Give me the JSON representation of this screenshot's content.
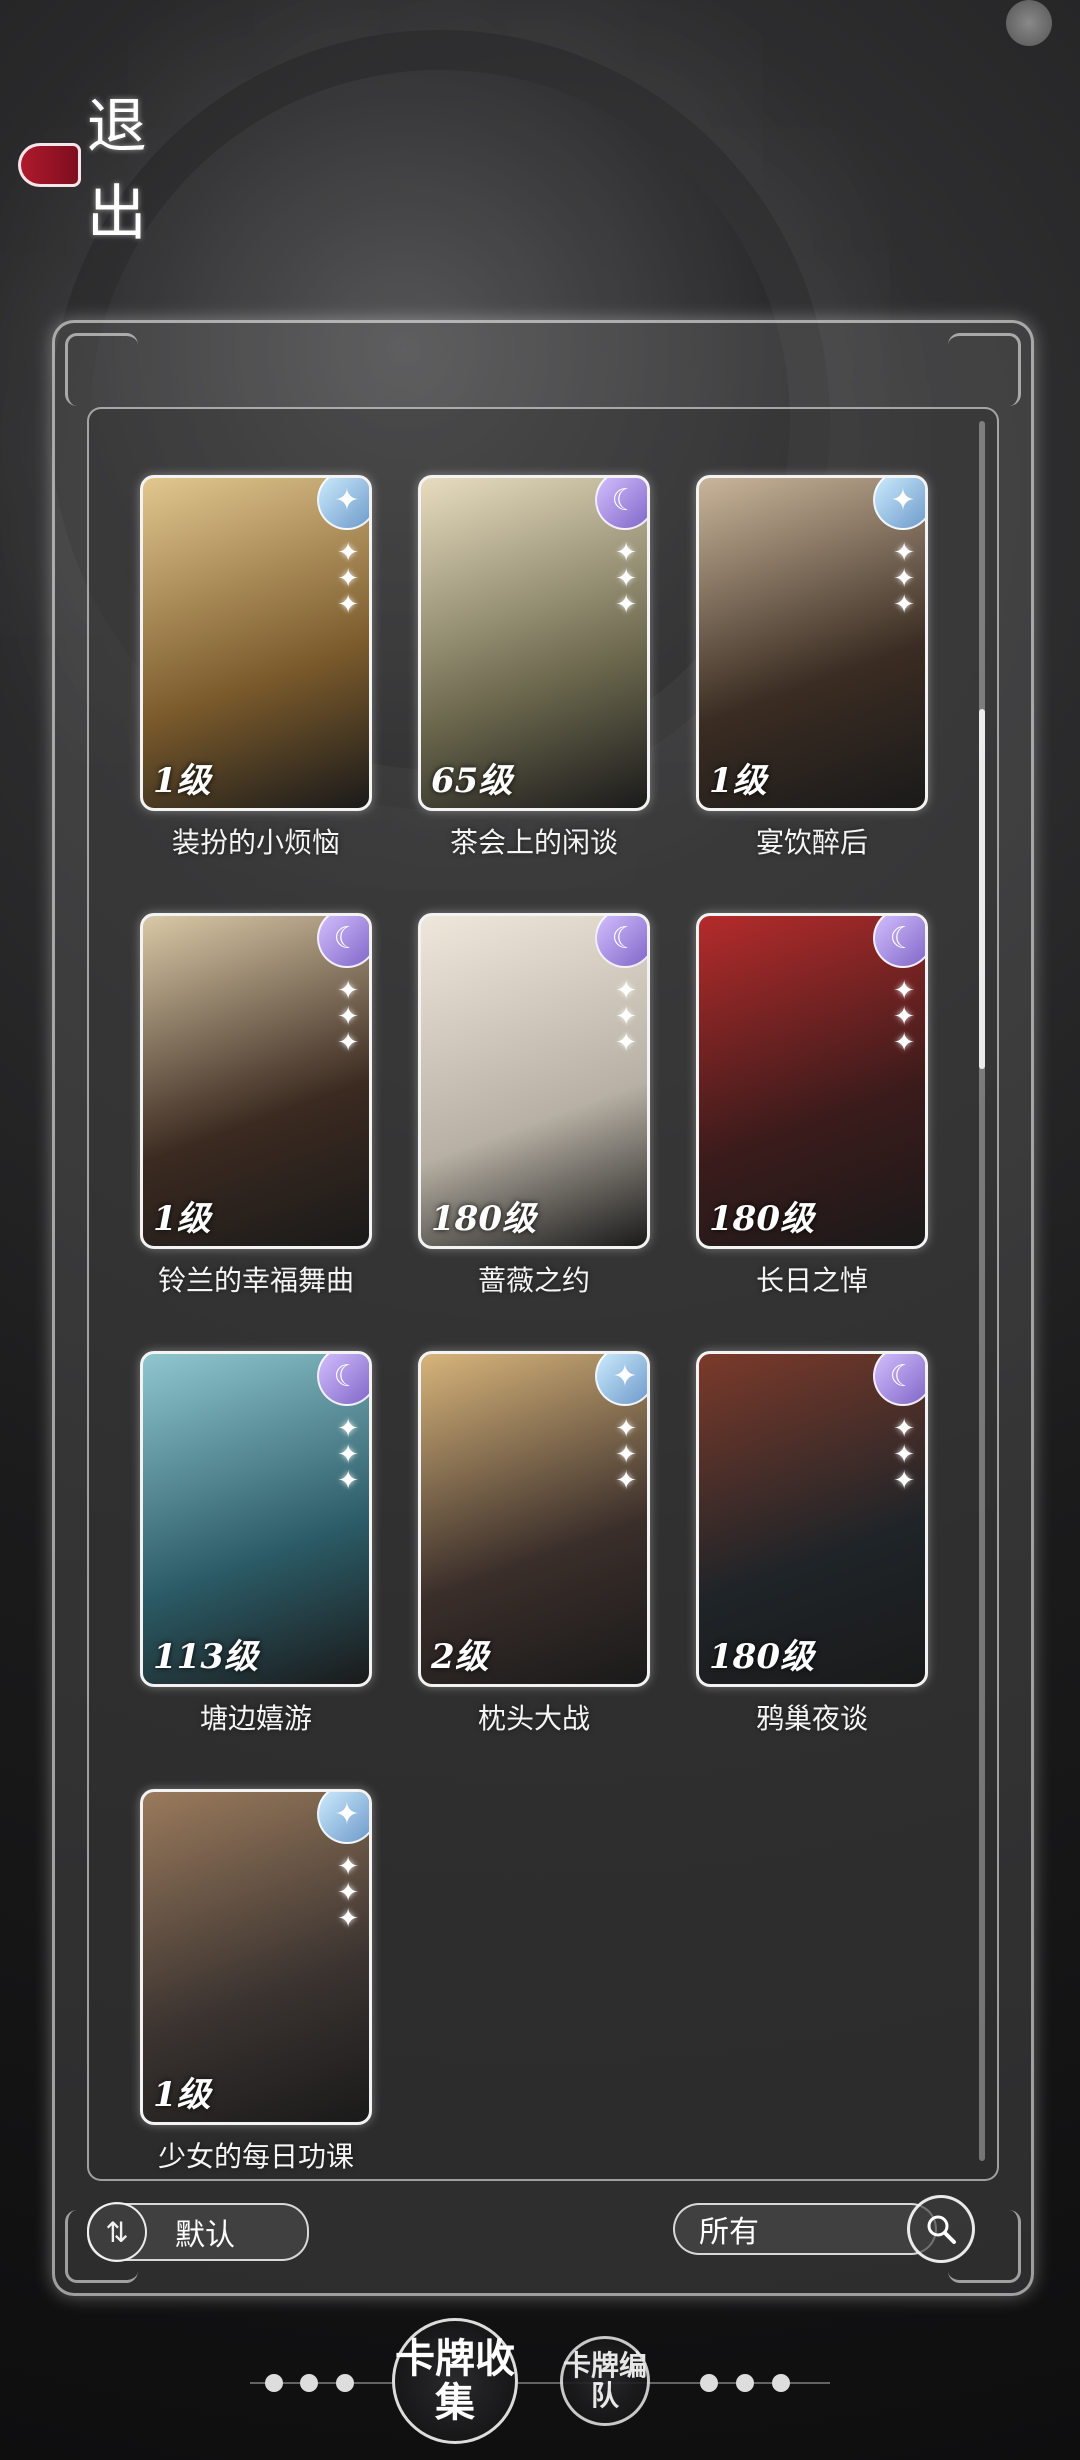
{
  "back_button": {
    "label": "退出"
  },
  "collection": {
    "partial_titles_above": [
      "",
      "",
      ""
    ],
    "cards": [
      {
        "title": "装扮的小烦恼",
        "level": "1级",
        "badge": "star-badge-icon",
        "art_colors": [
          "#7a5a2b",
          "#e2c78f"
        ]
      },
      {
        "title": "茶会上的闲谈",
        "level": "65级",
        "badge": "moon-badge-icon",
        "art_colors": [
          "#6e6a4f",
          "#e7dcc0"
        ]
      },
      {
        "title": "宴饮醉后",
        "level": "1级",
        "badge": "star-badge-icon",
        "art_colors": [
          "#3a2c22",
          "#c9b59a"
        ]
      },
      {
        "title": "铃兰的幸福舞曲",
        "level": "1级",
        "badge": "moon-badge-icon",
        "art_colors": [
          "#3b2a20",
          "#d9c9a7"
        ]
      },
      {
        "title": "蔷薇之约",
        "level": "180级",
        "badge": "moon-badge-icon",
        "art_colors": [
          "#b7b0a4",
          "#efe7da"
        ]
      },
      {
        "title": "长日之悼",
        "level": "180级",
        "badge": "moon-badge-icon",
        "art_colors": [
          "#3b1b1b",
          "#b52b2b"
        ]
      },
      {
        "title": "塘边嬉游",
        "level": "113级",
        "badge": "moon-badge-icon",
        "art_colors": [
          "#2b5b66",
          "#8fc7cf"
        ]
      },
      {
        "title": "枕头大战",
        "level": "2级",
        "badge": "star-badge-icon",
        "art_colors": [
          "#3a2e2a",
          "#d7b47a"
        ]
      },
      {
        "title": "鸦巢夜谈",
        "level": "180级",
        "badge": "moon-badge-icon",
        "art_colors": [
          "#1f2428",
          "#7b3a2a"
        ]
      },
      {
        "title": "少女的每日功课",
        "level": "1级",
        "badge": "star-badge-icon",
        "art_colors": [
          "#3a3330",
          "#9a7a5c"
        ]
      }
    ]
  },
  "controls": {
    "sort_label": "默认",
    "filter_value": "所有"
  },
  "bottom_nav": {
    "primary_label": "卡牌收集",
    "secondary_label": "卡牌编队"
  }
}
